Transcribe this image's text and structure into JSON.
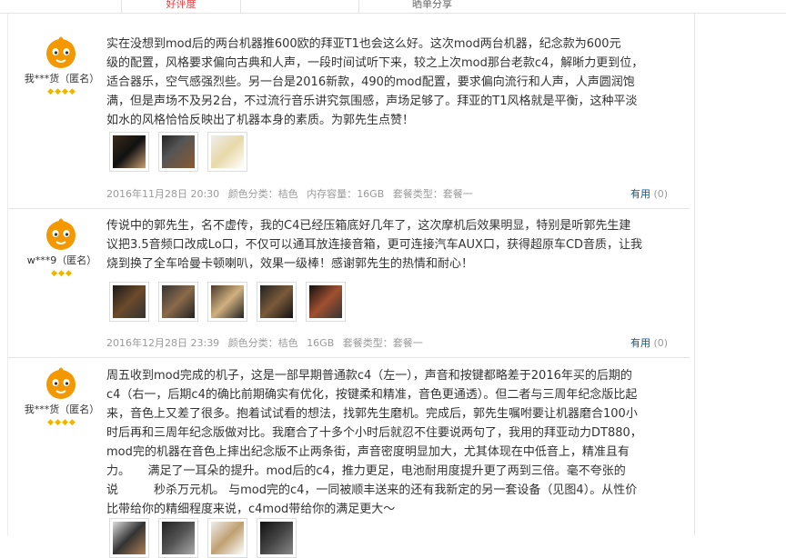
{
  "tabs": [
    "好评度",
    "晒单分享"
  ],
  "reviews": [
    {
      "user": "我***货（匿名）",
      "level": "◆◆◆◆",
      "lines": [
        "实在没想到mod后的两台机器推600欧的拜亚T1也会这么好。这次mod两台机器，纪念款为600元",
        "级的配置，风格要求偏向古典和人声，一段时间试听下来，较之上次mod那台老款c4，解晰力更到位，",
        "适合器乐，空气感强烈些。另一台是2016新款，490的mod配置，要求偏向流行和人声，人声圆润饱",
        "满，但是声场不及另2台，不过流行音乐讲究氛围感，声场足够了。拜亚的T1风格就是平衡，这种平淡",
        "如水的风格恰恰反映出了机器本身的素质。为郭先生点赞！"
      ],
      "date": "2016年11月28日 20:30",
      "color_label": "颜色分类：",
      "color": "桔色",
      "storage_label": "内存容量：",
      "storage": "16GB",
      "bundle_label": "套餐类型：",
      "bundle": "套餐一",
      "helpful": "有用",
      "helpful_count": "(0)"
    },
    {
      "user": "w***9（匿名）",
      "level": "◆◆◆",
      "lines": [
        "传说中的郭先生，名不虚传，我的C4已经压箱底好几年了，这次摩机后效果明显，特别是听郭先生建",
        "议把3.5音频口改成Lo口，不仅可以通耳放连接音箱，更可连接汽车AUX口，获得超原车CD音质，让我",
        "烧到换了全车哈曼卡顿喇叭，效果一级棒！感谢郭先生的热情和耐心！"
      ],
      "date": "2016年12月28日 23:39",
      "color_label": "颜色分类：",
      "color": "桔色",
      "storage_label": "",
      "storage": "16GB",
      "bundle_label": "套餐类型：",
      "bundle": "套餐一",
      "helpful": "有用",
      "helpful_count": "(0)"
    },
    {
      "user": "我***货（匿名）",
      "level": "◆◆◆◆",
      "lines": [
        "周五收到mod完成的机子，这是一部早期普通款c4（左一），声音和按键都略差于2016年买的后期的",
        "c4（右一，后期c4的确比前期确实有优化，按键柔和精准，音色更通透）。但二者与三周年纪念版比起",
        "来，音色上又差了很多。抱着试试看的想法，找郭先生磨机。完成后，郭先生嘱咐要让机器磨合100小",
        "时后再和三周年纪念版做对比。我磨合了十多个小时后就忍不住要说两句了，我用的拜亚动力DT880，",
        "mod完的机器在音色上摔出纪念版不止两条街，声音密度明显加大，尤其体现在中低音上，精准且有",
        "力。　　满足了一耳朵的提升。mod后的c4，推力更足，电池耐用度提升更了两到三倍。毫不夸张的",
        "说　　　秒杀万元机。 与mod完的c4，一同被顺丰送来的还有我新定的另一套设备（见图4）。从性价",
        "比带给你的精细程度来说，c4mod带给你的满足更大～"
      ]
    }
  ],
  "colors": {
    "accent": "#e4393c",
    "link": "#005aa0",
    "meta": "#9a9a9a",
    "avatar": "#f39800"
  },
  "icons": [
    "orange-mascot-avatar-icon",
    "diamond-level-icon",
    "photo-thumbnail"
  ]
}
